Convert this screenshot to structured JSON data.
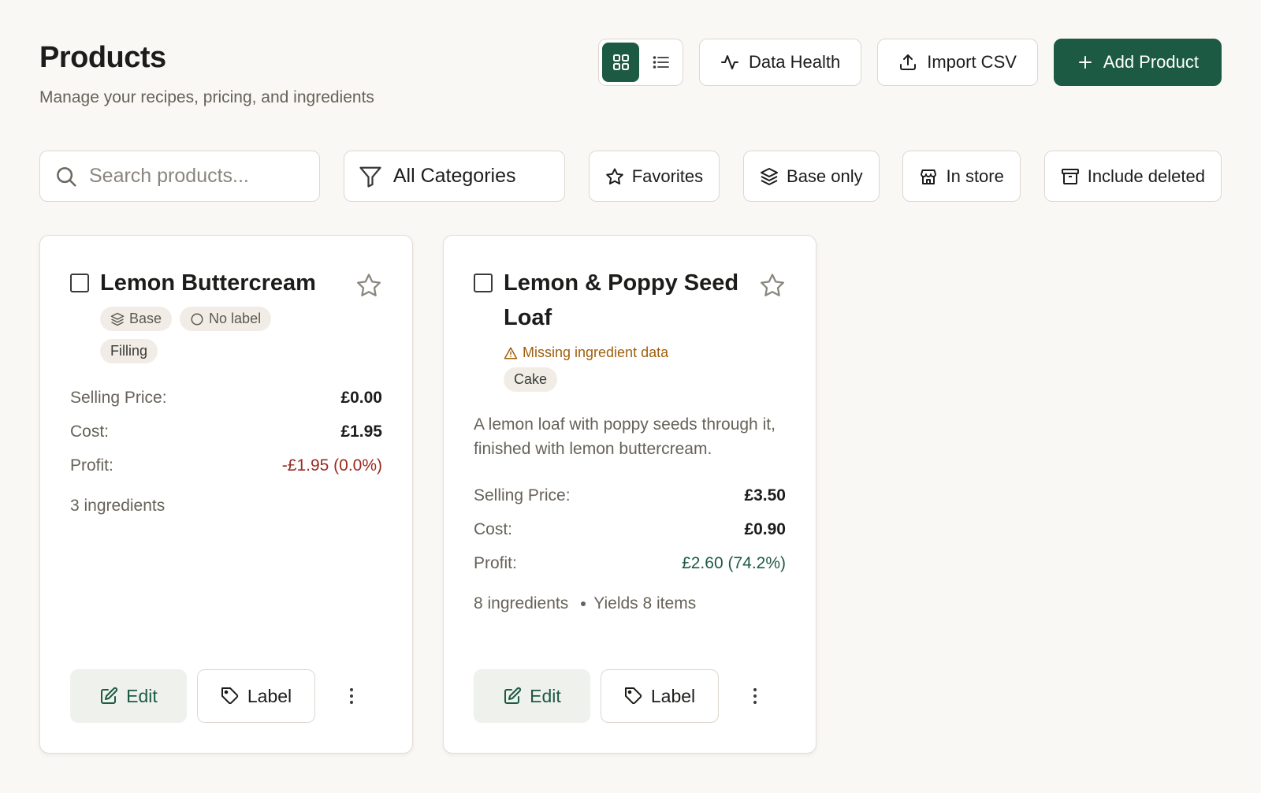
{
  "header": {
    "title": "Products",
    "subtitle": "Manage your recipes, pricing, and ingredients"
  },
  "actions": {
    "data_health": "Data Health",
    "import_csv": "Import CSV",
    "add_product": "Add Product",
    "view_mode": "grid"
  },
  "filters": {
    "search_placeholder": "Search products...",
    "category": "All Categories",
    "favorites": "Favorites",
    "base_only": "Base only",
    "in_store": "In store",
    "include_deleted": "Include deleted"
  },
  "products": [
    {
      "name": "Lemon Buttercream",
      "tags": [
        "Base",
        "No label",
        "Filling"
      ],
      "selling_price_label": "Selling Price:",
      "selling_price": "£0.00",
      "cost_label": "Cost:",
      "cost": "£1.95",
      "profit_label": "Profit:",
      "profit": "-£1.95 (0.0%)",
      "ingredients": "3 ingredients",
      "edit_label": "Edit",
      "label_label": "Label"
    },
    {
      "name": "Lemon & Poppy Seed Loaf",
      "warning": "Missing ingredient data",
      "tags": [
        "Cake"
      ],
      "description": "A lemon loaf with poppy seeds through it, finished with lemon buttercream.",
      "selling_price_label": "Selling Price:",
      "selling_price": "£3.50",
      "cost_label": "Cost:",
      "cost": "£0.90",
      "profit_label": "Profit:",
      "profit": "£2.60 (74.2%)",
      "ingredients": "8 ingredients",
      "yields": "Yields 8 items",
      "edit_label": "Edit",
      "label_label": "Label"
    }
  ],
  "colors": {
    "primary": "#1d5a43",
    "negative": "#9a2a1e",
    "warning": "#a05e0c",
    "background": "#faf8f5"
  }
}
